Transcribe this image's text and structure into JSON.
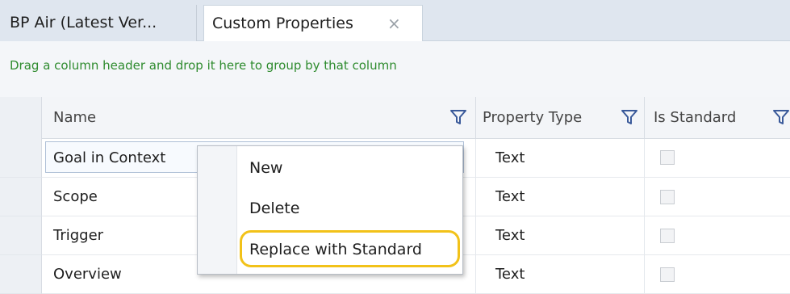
{
  "tabs": [
    {
      "label": "BP Air (Latest Ver..."
    },
    {
      "label": "Custom Properties",
      "close": "×"
    }
  ],
  "group_hint": "Drag a column header and drop it here to group by that column",
  "columns": [
    {
      "label": "Name"
    },
    {
      "label": "Property Type"
    },
    {
      "label": "Is Standard"
    }
  ],
  "rows": [
    {
      "name": "Goal in Context",
      "type": "Text",
      "is_standard": false
    },
    {
      "name": "Scope",
      "type": "Text",
      "is_standard": false
    },
    {
      "name": "Trigger",
      "type": "Text",
      "is_standard": false
    },
    {
      "name": "Overview",
      "type": "Text",
      "is_standard": false
    }
  ],
  "context_menu": {
    "items": [
      {
        "label": "New"
      },
      {
        "label": "Delete"
      },
      {
        "label": "Replace with Standard"
      }
    ]
  },
  "colors": {
    "group_hint_text": "#2e8b2e",
    "highlight": "#f2c219",
    "filter_icon": "#3a5a9a"
  }
}
